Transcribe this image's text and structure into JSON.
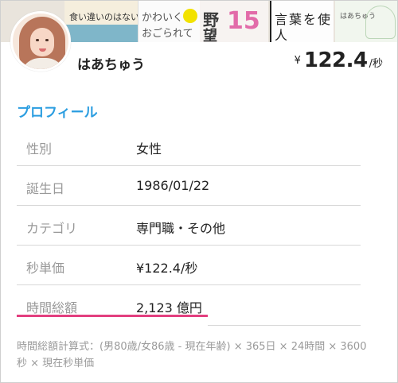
{
  "banner": {
    "book1": "食い違いのはない",
    "book2": [
      "かわいく",
      "おごられて"
    ],
    "book3": [
      "野",
      "望",
      "15"
    ],
    "book4": [
      "言葉を使",
      "人　　い"
    ],
    "book5": "はあちゅう"
  },
  "profile": {
    "name": "はあちゅう",
    "rate_currency": "¥",
    "rate_value": "122.4",
    "rate_unit": "/秒"
  },
  "section_title": "プロフィール",
  "rows": [
    {
      "label": "性別",
      "value": "女性"
    },
    {
      "label": "誕生日",
      "value": "1986/01/22"
    },
    {
      "label": "カテゴリ",
      "value": "専門職・その他"
    },
    {
      "label": "秒単価",
      "value": "¥122.4/秒"
    },
    {
      "label": "時間総額",
      "value": "2,123 億円"
    }
  ],
  "formula": "時間総額計算式：(男80歳/女86歳 - 現在年齢) × 365日 × 24時間 × 3600秒 × 現在秒単価",
  "colors": {
    "accent": "#2a9de0",
    "highlight": "#e33f7f"
  }
}
